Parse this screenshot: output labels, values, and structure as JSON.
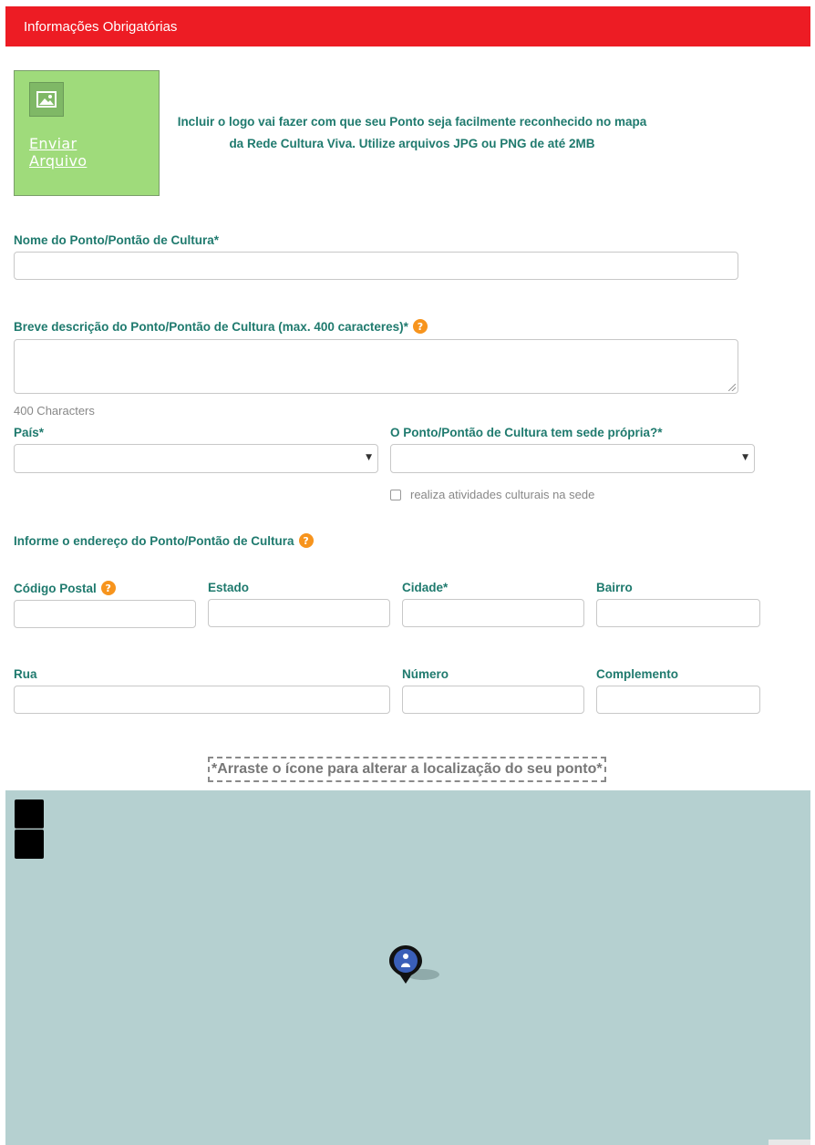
{
  "header": {
    "title": "Informações Obrigatórias"
  },
  "upload": {
    "link_label": "Enviar Arquivo",
    "icon": "image-icon",
    "hint": "Incluir o logo vai fazer com que seu Ponto seja facilmente reconhecido no mapa da Rede Cultura Viva. Utilize arquivos JPG ou PNG de até 2MB"
  },
  "fields": {
    "name_label": "Nome do Ponto/Pontão de Cultura*",
    "description_label": "Breve descrição do Ponto/Pontão de Cultura (max. 400 caracteres)*",
    "description_counter": "400 Characters",
    "country_label": "País*",
    "headquarters_label": "O Ponto/Pontão de Cultura tem sede própria?*",
    "activities_checkbox_label": "realiza atividades culturais na sede",
    "address_section_label": "Informe o endereço do Ponto/Pontão de Cultura",
    "postal_code_label": "Código Postal",
    "state_label": "Estado",
    "city_label": "Cidade*",
    "district_label": "Bairro",
    "street_label": "Rua",
    "number_label": "Número",
    "complement_label": "Complemento",
    "help_glyph": "?"
  },
  "map": {
    "drag_hint": "*Arraste o ícone para alterar a localização do seu ponto*",
    "zoom_in_icon": "zoom-in-icon",
    "zoom_out_icon": "zoom-out-icon",
    "marker_icon": "person-marker-icon",
    "background_color": "#b5d0d0"
  },
  "colors": {
    "header": "#ed1c24",
    "label_text": "#1f7a6e",
    "upload_box": "#9fdb7b",
    "help_badge": "#f7941d"
  }
}
